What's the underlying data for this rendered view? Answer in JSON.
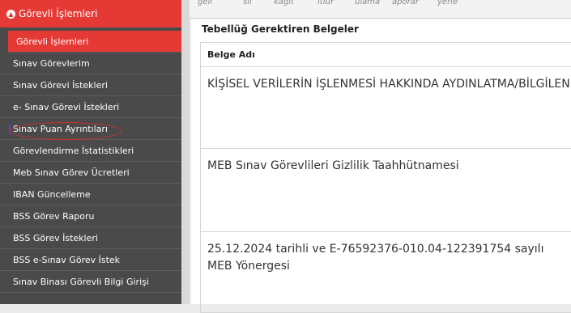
{
  "sidebar": {
    "header": "Görevli İşlemleri",
    "items": [
      {
        "label": "Görevli İşlemleri"
      },
      {
        "label": "Sınav Görevlerim"
      },
      {
        "label": "Sınav Görevi İstekleri"
      },
      {
        "label": "e- Sınav Görevi İstekleri"
      },
      {
        "label": "Sınav Puan Ayrıntıları"
      },
      {
        "label": "Görevlendirme İstatistikleri"
      },
      {
        "label": "Meb Sınav Görev Ücretleri"
      },
      {
        "label": "IBAN Güncelleme"
      },
      {
        "label": "BSS Görev Raporu"
      },
      {
        "label": "BSS Görev İstekleri"
      },
      {
        "label": "BSS e-Sınav Görev İstek"
      },
      {
        "label": "Sınav Binası Görevli Bilgi Girişi"
      }
    ]
  },
  "toolbar": {
    "labels": [
      "gell",
      "sil",
      "kağıt",
      "ıtıur",
      "ulama",
      "aporar",
      "yerie"
    ]
  },
  "panel": {
    "title": "Tebellüğ Gerektiren Belgeler",
    "column_header": "Belge Adı",
    "rows": [
      "KİŞİSEL VERİLERİN İŞLENMESİ HAKKINDA AYDINLATMA/BİLGİLENDİRME",
      "MEB Sınav Görevlileri Gizlilik Taahhütnamesi",
      "25.12.2024 tarihli ve E-76592376-010.04-122391754 sayılı MEB Yönergesi"
    ]
  },
  "colors": {
    "accent": "#e53935",
    "sidebar_bg": "#4a4a4a",
    "annotation": "#d32f2f"
  }
}
